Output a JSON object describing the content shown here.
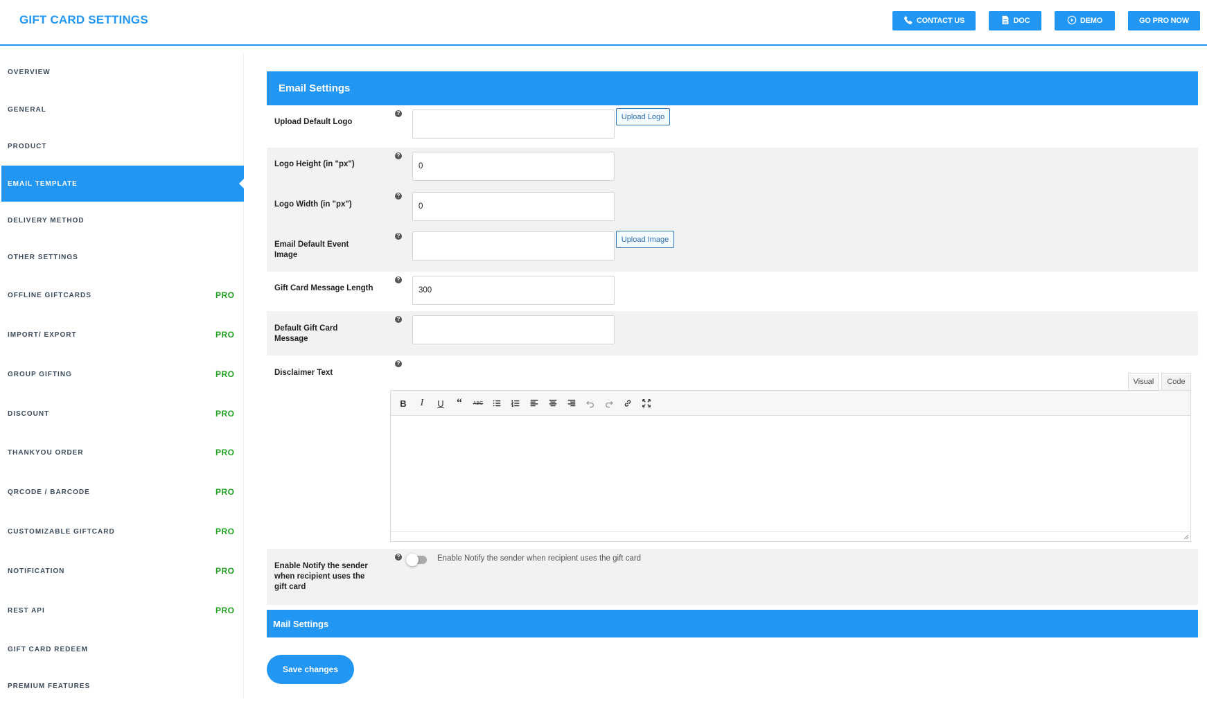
{
  "header": {
    "title": "GIFT CARD SETTINGS",
    "buttons": {
      "contact": "CONTACT US",
      "doc": "DOC",
      "demo": "DEMO",
      "pro": "GO PRO NOW"
    }
  },
  "sidebar": {
    "items": [
      {
        "label": "OVERVIEW",
        "pro": ""
      },
      {
        "label": "GENERAL",
        "pro": ""
      },
      {
        "label": "PRODUCT",
        "pro": ""
      },
      {
        "label": "EMAIL TEMPLATE",
        "pro": "",
        "active": true
      },
      {
        "label": "DELIVERY METHOD",
        "pro": ""
      },
      {
        "label": "OTHER SETTINGS",
        "pro": ""
      },
      {
        "label": "OFFLINE GIFTCARDS",
        "pro": "PRO"
      },
      {
        "label": "IMPORT/ EXPORT",
        "pro": "PRO"
      },
      {
        "label": "GROUP GIFTING",
        "pro": "PRO"
      },
      {
        "label": "DISCOUNT",
        "pro": "PRO"
      },
      {
        "label": "THANKYOU ORDER",
        "pro": "PRO"
      },
      {
        "label": "QRCODE / BARCODE",
        "pro": "PRO"
      },
      {
        "label": "CUSTOMIZABLE GIFTCARD",
        "pro": "PRO"
      },
      {
        "label": "NOTIFICATION",
        "pro": "PRO"
      },
      {
        "label": "REST API",
        "pro": "PRO"
      },
      {
        "label": "GIFT CARD REDEEM",
        "pro": ""
      },
      {
        "label": "PREMIUM FEATURES",
        "pro": ""
      }
    ]
  },
  "email_settings": {
    "heading": "Email Settings",
    "help_symbol": "?",
    "upload_logo": {
      "label": "Upload Default Logo",
      "value": "",
      "button": "Upload Logo"
    },
    "logo_height": {
      "label": "Logo Height (in \"px\")",
      "value": "0"
    },
    "logo_width": {
      "label": "Logo Width (in \"px\")",
      "value": "0"
    },
    "event_image": {
      "label": "Email Default Event Image",
      "value": "",
      "button": "Upload Image"
    },
    "message_length": {
      "label": "Gift Card Message Length",
      "value": "300"
    },
    "default_message": {
      "label": "Default Gift Card Message",
      "value": ""
    },
    "disclaimer": {
      "label": "Disclaimer Text",
      "tabs": {
        "visual": "Visual",
        "code": "Code"
      },
      "active_tab": "Visual"
    },
    "notify_sender": {
      "label": "Enable Notify the sender when recipient uses the gift card",
      "description": "Enable Notify the sender when recipient uses the gift card",
      "enabled": false
    }
  },
  "mail_settings": {
    "heading": "Mail Settings"
  },
  "actions": {
    "save": "Save changes"
  },
  "colors": {
    "accent": "#2196f3",
    "pro": "#22a022"
  }
}
